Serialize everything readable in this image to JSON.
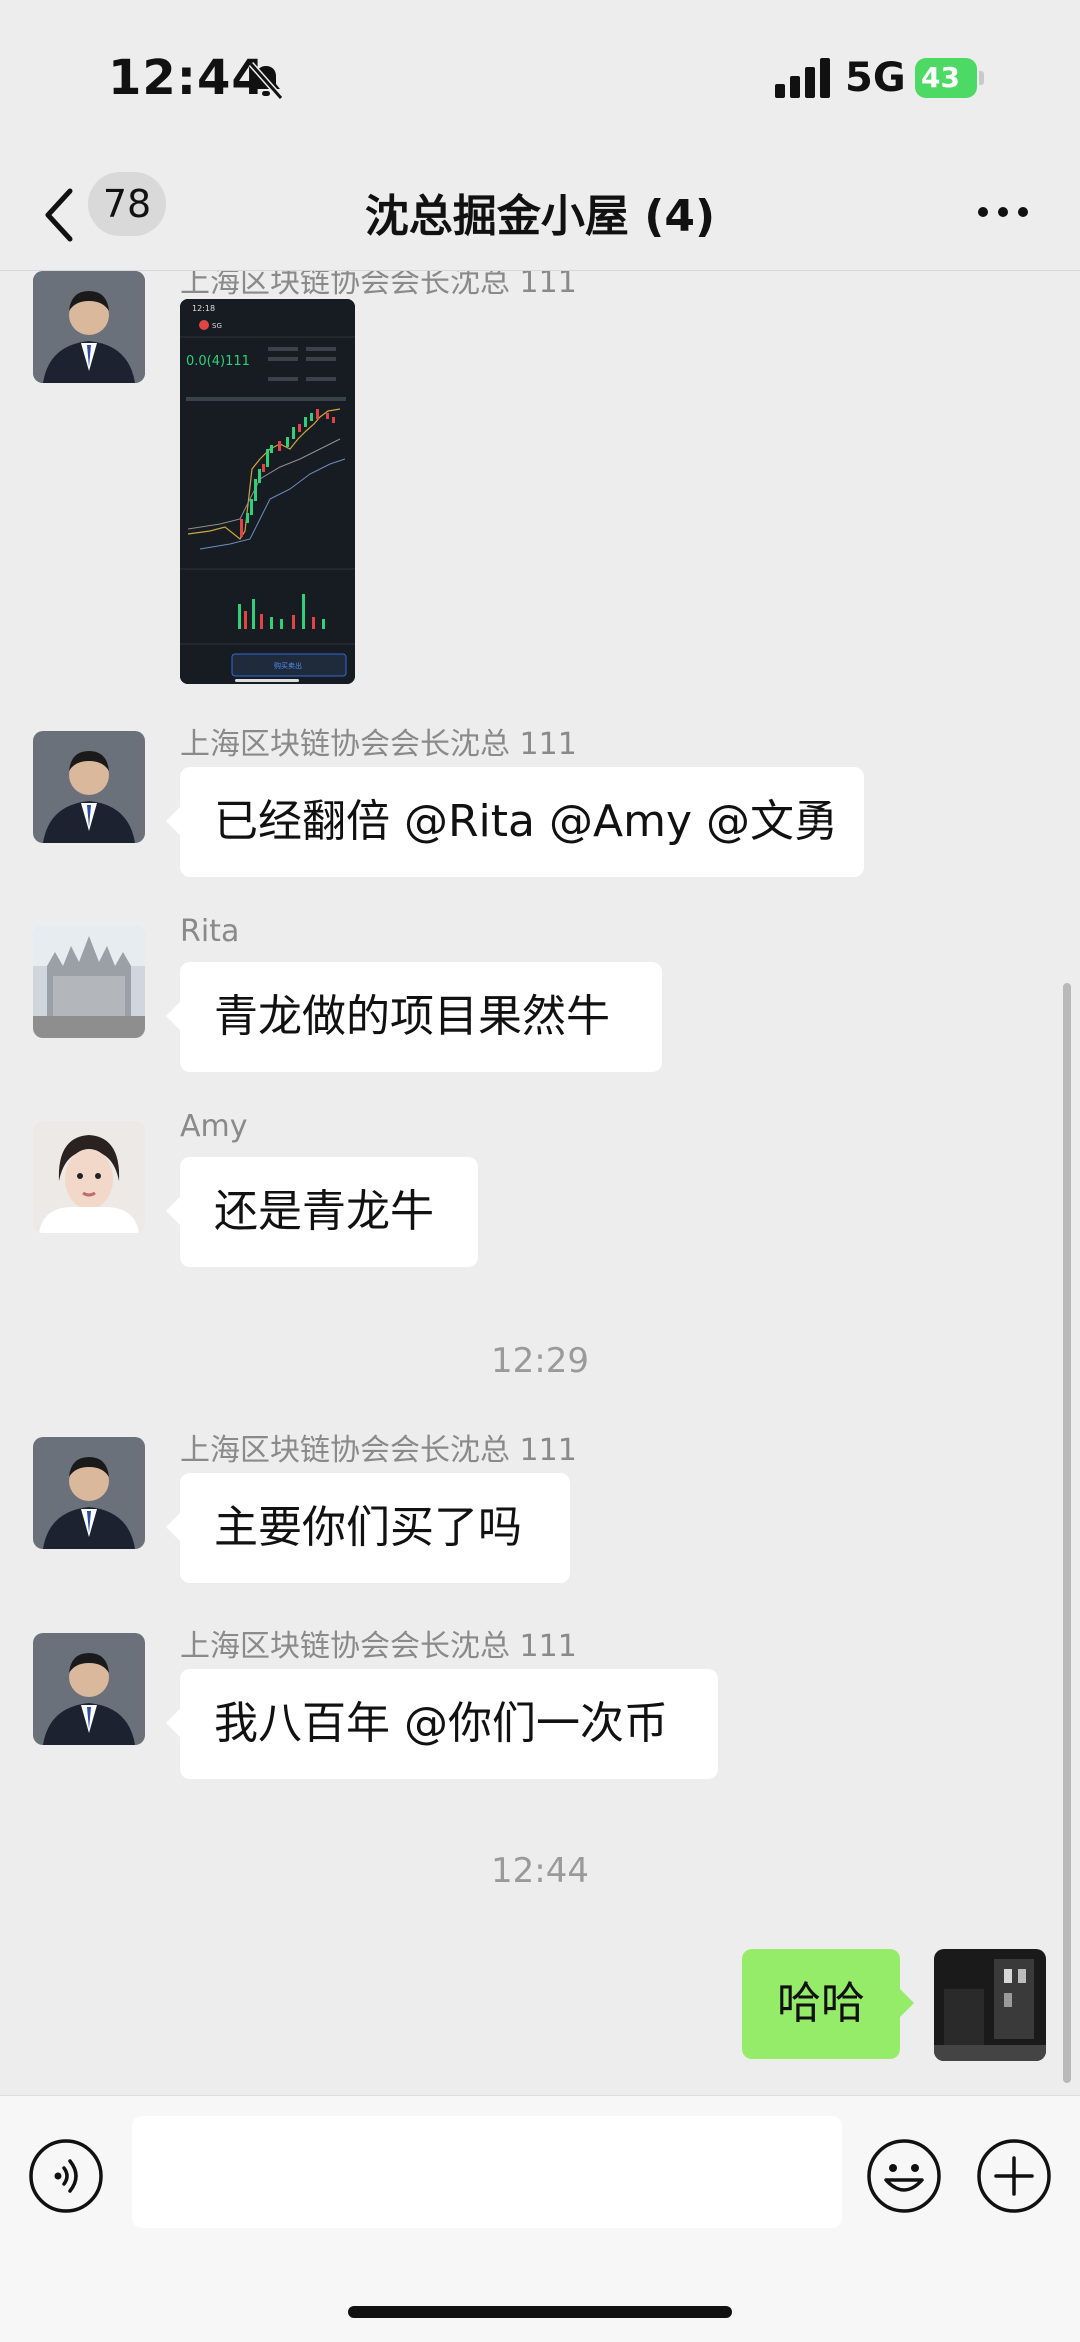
{
  "status_bar": {
    "time": "12:44",
    "network": "5G",
    "battery": "43"
  },
  "nav": {
    "back_count": "78",
    "title": "沈总掘金小屋 (4)"
  },
  "messages": [
    {
      "type": "image",
      "sender": "上海区块链协会会长沈总 111",
      "image_texts": {
        "time": "12:18",
        "symbol": "SG",
        "price": "0.0(4)111",
        "button": "购买卖出"
      }
    },
    {
      "type": "text",
      "sender": "上海区块链协会会长沈总 111",
      "text": "已经翻倍 @Rita @Amy @文勇"
    },
    {
      "type": "text",
      "sender": "Rita",
      "text": "青龙做的项目果然牛"
    },
    {
      "type": "text",
      "sender": "Amy",
      "text": "还是青龙牛"
    },
    {
      "type": "timestamp",
      "text": "12:29"
    },
    {
      "type": "text",
      "sender": "上海区块链协会会长沈总 111",
      "text": "主要你们买了吗"
    },
    {
      "type": "text",
      "sender": "上海区块链协会会长沈总 111",
      "text": "我八百年 @你们一次币"
    },
    {
      "type": "timestamp",
      "text": "12:44"
    },
    {
      "type": "self",
      "text": "哈哈"
    }
  ],
  "input": {
    "value": ""
  },
  "icons": {
    "back": "chevron-left-icon",
    "more": "more-icon",
    "voice": "voice-icon",
    "emoji": "emoji-icon",
    "plus": "plus-icon",
    "mute": "bell-slash-icon"
  },
  "colors": {
    "self_bubble": "#95ec69",
    "other_bubble": "#ffffff",
    "background": "#ededed",
    "battery": "#4cd964"
  }
}
